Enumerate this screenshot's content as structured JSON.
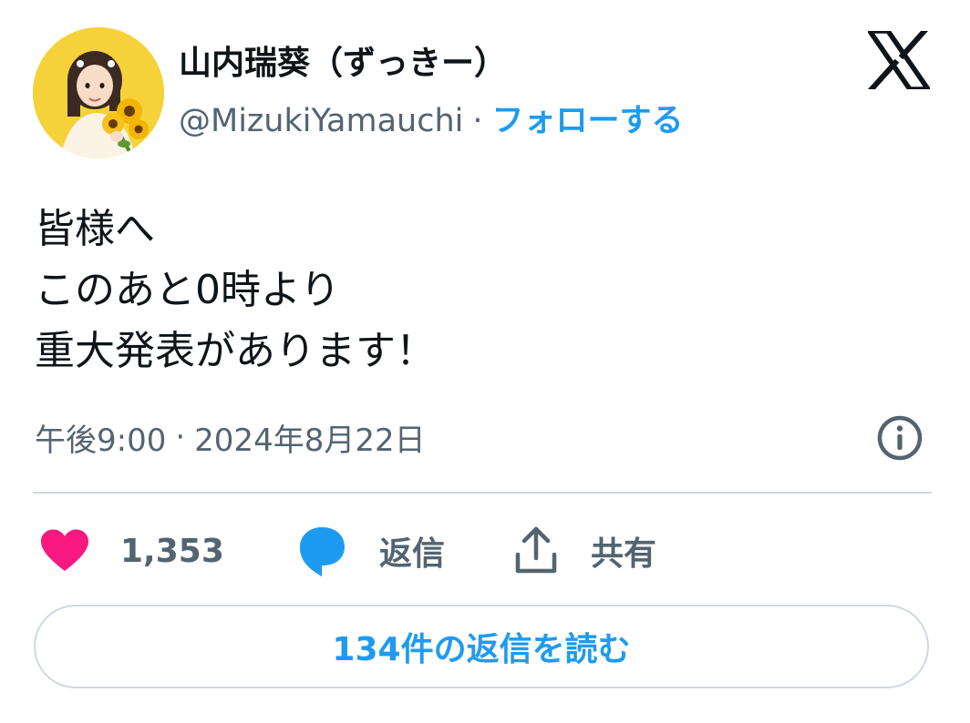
{
  "author": {
    "display_name": "山内瑞葵（ずっきー）",
    "handle": "@MizukiYamauchi",
    "separator": "·",
    "follow_label": "フォローする",
    "avatar_icon": "profile-photo-sunflower-yellow-background"
  },
  "brand": {
    "logo_icon": "x-logo-icon"
  },
  "tweet": {
    "lines": [
      "皆様へ",
      "このあと0時より",
      "重大発表があります！"
    ],
    "time": "午後9:00",
    "separator": "·",
    "date": "2024年8月22日"
  },
  "actions": {
    "like_count": "1,353",
    "reply_label": "返信",
    "share_label": "共有"
  },
  "read_replies_label": "134件の返信を読む",
  "colors": {
    "accent": "#1d9bf0",
    "like": "#f91880",
    "secondary_text": "#536471",
    "border": "#cfd9de",
    "avatar_background": "#f6d23a"
  }
}
